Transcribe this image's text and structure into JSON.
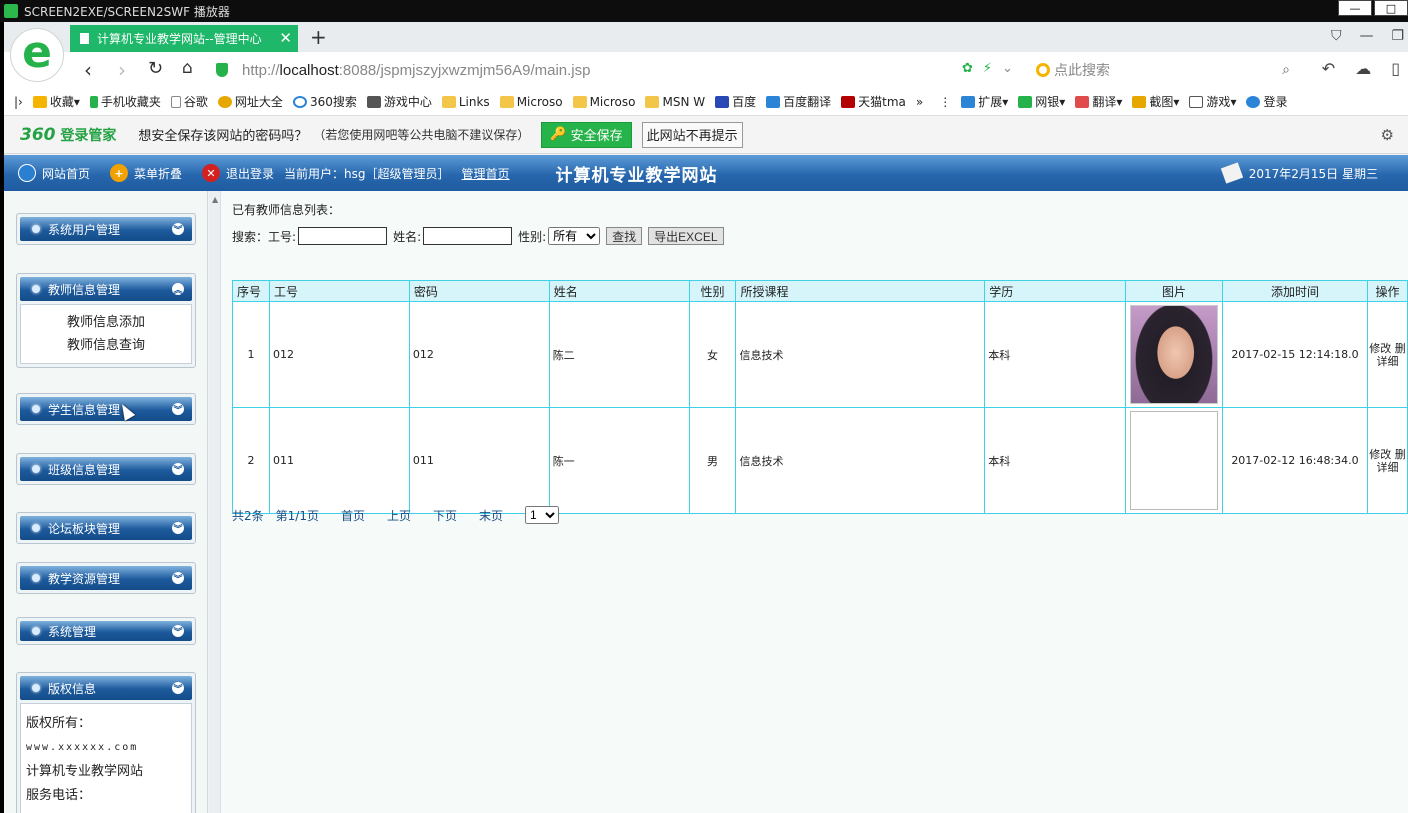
{
  "os_window": {
    "title": "SCREEN2EXE/SCREEN2SWF 播放器"
  },
  "browser": {
    "tab_title": "计算机专业教学网站--管理中心",
    "url_prefix": "http://",
    "url_host": "localhost",
    "url_rest": ":8088/jspmjszyjxwzmjm56A9/main.jsp",
    "search_placeholder": "点此搜索",
    "bookmarks": [
      "收藏",
      "手机收藏夹",
      "谷歌",
      "网址大全",
      "360搜索",
      "游戏中心",
      "Links",
      "Microso",
      "Microso",
      "MSN W",
      "百度",
      "百度翻译",
      "天猫tma",
      "扩展",
      "网银",
      "翻译",
      "截图",
      "游戏",
      "登录"
    ],
    "colors": {
      "accent": "#1fb86a",
      "header_blue": "#2767ad",
      "table_border": "#3fd2e6"
    }
  },
  "pwdbar": {
    "brand": "360",
    "brand_suffix": "登录管家",
    "question": "想安全保存该网站的密码吗？",
    "hint": "（若您使用网吧等公共电脑不建议保存）",
    "save_label": "安全保存",
    "never_label": "此网站不再提示"
  },
  "header": {
    "home": "网站首页",
    "fold_menu": "菜单折叠",
    "logout": "退出登录",
    "current_user": "当前用户：hsg［超级管理员］",
    "admin_home": "管理首页",
    "site_title": "计算机专业教学网站",
    "date": "2017年2月15日 星期三"
  },
  "sidebar": {
    "menus": [
      {
        "label": "系统用户管理"
      },
      {
        "label": "教师信息管理",
        "items": [
          "教师信息添加",
          "教师信息查询"
        ]
      },
      {
        "label": "学生信息管理"
      },
      {
        "label": "班级信息管理"
      },
      {
        "label": "论坛板块管理"
      },
      {
        "label": "教学资源管理"
      },
      {
        "label": "系统管理"
      }
    ],
    "copyright": {
      "label": "版权信息",
      "line1": "版权所有：",
      "line2": "www.xxxxxx.com",
      "line3": "计算机专业教学网站",
      "line4": "服务电话："
    }
  },
  "main": {
    "list_title": "已有教师信息列表：",
    "search": {
      "label": "搜索：",
      "id_label": "工号:",
      "name_label": "姓名:",
      "gender_label": "性别:",
      "gender_selected": "所有",
      "find_button": "查找",
      "export_button": "导出EXCEL"
    },
    "table": {
      "headers": [
        "序号",
        "工号",
        "密码",
        "姓名",
        "性别",
        "所授课程",
        "学历",
        "图片",
        "添加时间",
        "操作"
      ],
      "rows": [
        {
          "no": "1",
          "id": "012",
          "pwd": "012",
          "name": "陈二",
          "gender": "女",
          "course": "信息技术",
          "edu": "本科",
          "time": "2017-02-15 12:14:18.0",
          "op1": "修改 删",
          "op2": "详细"
        },
        {
          "no": "2",
          "id": "011",
          "pwd": "011",
          "name": "陈一",
          "gender": "男",
          "course": "信息技术",
          "edu": "本科",
          "time": "2017-02-12 16:48:34.0",
          "op1": "修改 删",
          "op2": "详细"
        }
      ]
    },
    "pager": {
      "total": "共2条",
      "page": "第1/1页",
      "first": "首页",
      "prev": "上页",
      "next": "下页",
      "last": "末页",
      "selected": "1"
    }
  }
}
